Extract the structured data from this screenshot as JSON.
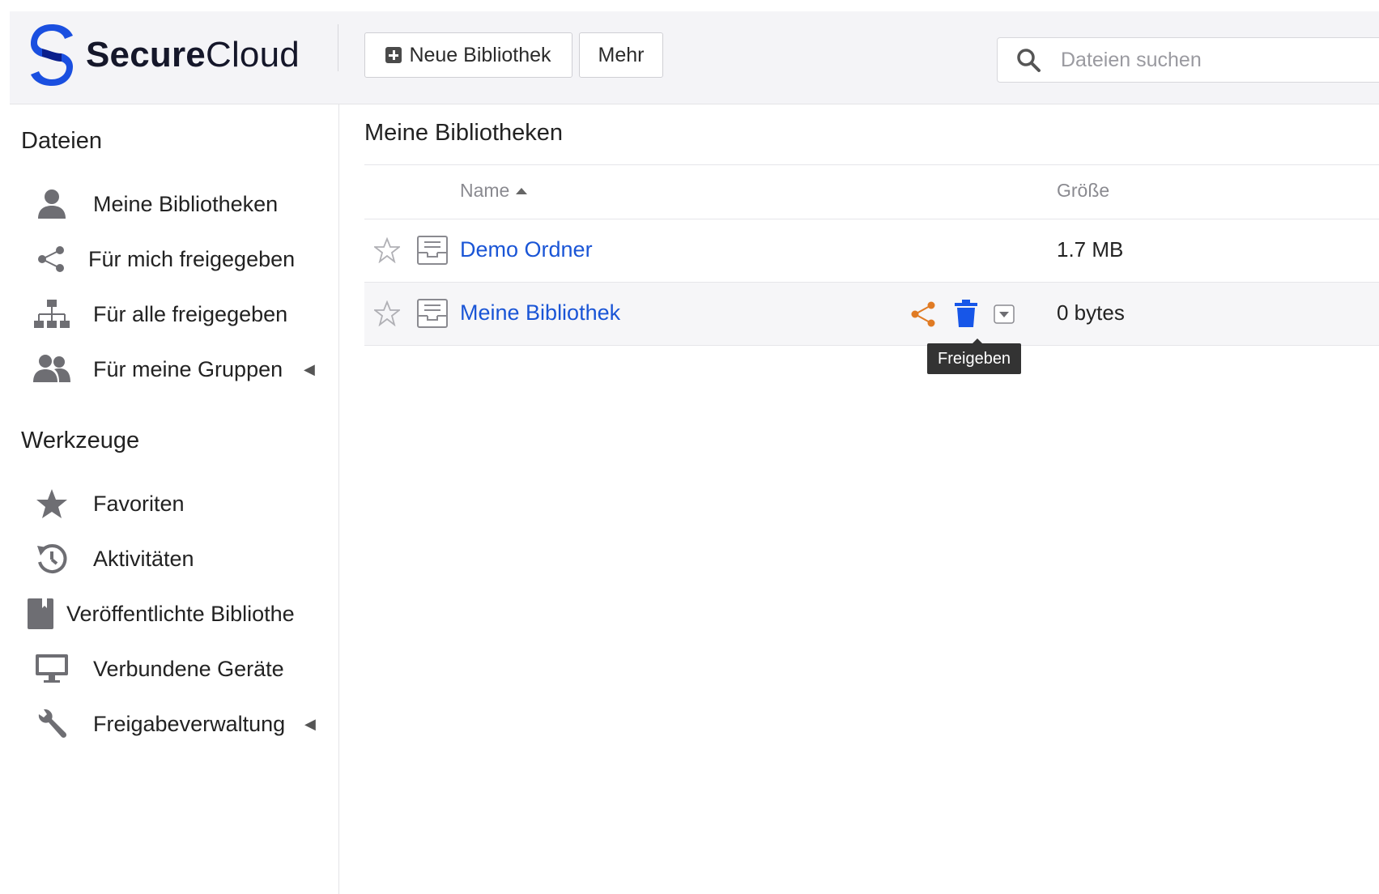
{
  "header": {
    "logo_bold": "Secure",
    "logo_light": "Cloud",
    "new_library_label": "Neue Bibliothek",
    "more_label": "Mehr",
    "search_placeholder": "Dateien suchen"
  },
  "sidebar": {
    "files_title": "Dateien",
    "files_items": [
      {
        "label": "Meine Bibliotheken",
        "icon": "user-icon"
      },
      {
        "label": "Für mich freigegeben",
        "icon": "share-icon"
      },
      {
        "label": "Für alle freigegeben",
        "icon": "org-icon"
      },
      {
        "label": "Für meine Gruppen",
        "icon": "group-icon"
      }
    ],
    "tools_title": "Werkzeuge",
    "tools_items": [
      {
        "label": "Favoriten",
        "icon": "star-icon"
      },
      {
        "label": "Aktivitäten",
        "icon": "history-icon"
      },
      {
        "label": "Veröffentlichte Bibliothe",
        "icon": "book-icon"
      },
      {
        "label": "Verbundene Geräte",
        "icon": "monitor-icon"
      },
      {
        "label": "Freigabeverwaltung",
        "icon": "wrench-icon"
      }
    ]
  },
  "main": {
    "title": "Meine Bibliotheken",
    "columns": {
      "name": "Name",
      "size": "Größe"
    },
    "rows": [
      {
        "name": "Demo Ordner",
        "size": "1.7 MB"
      },
      {
        "name": "Meine Bibliothek",
        "size": "0 bytes"
      }
    ],
    "tooltip": "Freigeben"
  },
  "colors": {
    "link": "#1a55d6",
    "share_icon": "#e07b24",
    "trash_icon": "#1756e8",
    "logo_blue": "#1a4fe0"
  }
}
